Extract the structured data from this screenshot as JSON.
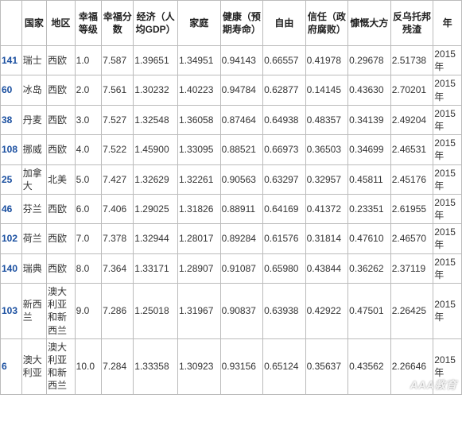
{
  "headers": [
    "",
    "国家",
    "地区",
    "幸福等级",
    "幸福分数",
    "经济（人均GDP）",
    "家庭",
    "健康（预期寿命）",
    "自由",
    "信任（政府腐败）",
    "慷慨大方",
    "反乌托邦残渣",
    "年"
  ],
  "rows": [
    {
      "idx": "141",
      "country": "瑞士",
      "region": "西欧",
      "rank": "1.0",
      "score": "7.587",
      "econ": "1.39651",
      "family": "1.34951",
      "health": "0.94143",
      "freedom": "0.66557",
      "trust": "0.41978",
      "gen": "0.29678",
      "dys": "2.51738",
      "year": "2015年"
    },
    {
      "idx": "60",
      "country": "冰岛",
      "region": "西欧",
      "rank": "2.0",
      "score": "7.561",
      "econ": "1.30232",
      "family": "1.40223",
      "health": "0.94784",
      "freedom": "0.62877",
      "trust": "0.14145",
      "gen": "0.43630",
      "dys": "2.70201",
      "year": "2015年"
    },
    {
      "idx": "38",
      "country": "丹麦",
      "region": "西欧",
      "rank": "3.0",
      "score": "7.527",
      "econ": "1.32548",
      "family": "1.36058",
      "health": "0.87464",
      "freedom": "0.64938",
      "trust": "0.48357",
      "gen": "0.34139",
      "dys": "2.49204",
      "year": "2015年"
    },
    {
      "idx": "108",
      "country": "挪威",
      "region": "西欧",
      "rank": "4.0",
      "score": "7.522",
      "econ": "1.45900",
      "family": "1.33095",
      "health": "0.88521",
      "freedom": "0.66973",
      "trust": "0.36503",
      "gen": "0.34699",
      "dys": "2.46531",
      "year": "2015年"
    },
    {
      "idx": "25",
      "country": "加拿大",
      "region": "北美",
      "rank": "5.0",
      "score": "7.427",
      "econ": "1.32629",
      "family": "1.32261",
      "health": "0.90563",
      "freedom": "0.63297",
      "trust": "0.32957",
      "gen": "0.45811",
      "dys": "2.45176",
      "year": "2015年"
    },
    {
      "idx": "46",
      "country": "芬兰",
      "region": "西欧",
      "rank": "6.0",
      "score": "7.406",
      "econ": "1.29025",
      "family": "1.31826",
      "health": "0.88911",
      "freedom": "0.64169",
      "trust": "0.41372",
      "gen": "0.23351",
      "dys": "2.61955",
      "year": "2015年"
    },
    {
      "idx": "102",
      "country": "荷兰",
      "region": "西欧",
      "rank": "7.0",
      "score": "7.378",
      "econ": "1.32944",
      "family": "1.28017",
      "health": "0.89284",
      "freedom": "0.61576",
      "trust": "0.31814",
      "gen": "0.47610",
      "dys": "2.46570",
      "year": "2015年"
    },
    {
      "idx": "140",
      "country": "瑞典",
      "region": "西欧",
      "rank": "8.0",
      "score": "7.364",
      "econ": "1.33171",
      "family": "1.28907",
      "health": "0.91087",
      "freedom": "0.65980",
      "trust": "0.43844",
      "gen": "0.36262",
      "dys": "2.37119",
      "year": "2015年"
    },
    {
      "idx": "103",
      "country": "新西兰",
      "region": "澳大利亚和新西兰",
      "rank": "9.0",
      "score": "7.286",
      "econ": "1.25018",
      "family": "1.31967",
      "health": "0.90837",
      "freedom": "0.63938",
      "trust": "0.42922",
      "gen": "0.47501",
      "dys": "2.26425",
      "year": "2015年"
    },
    {
      "idx": "6",
      "country": "澳大利亚",
      "region": "澳大利亚和新西兰",
      "rank": "10.0",
      "score": "7.284",
      "econ": "1.33358",
      "family": "1.30923",
      "health": "0.93156",
      "freedom": "0.65124",
      "trust": "0.35637",
      "gen": "0.43562",
      "dys": "2.26646",
      "year": "2015年"
    }
  ],
  "watermark": "AAA教育"
}
